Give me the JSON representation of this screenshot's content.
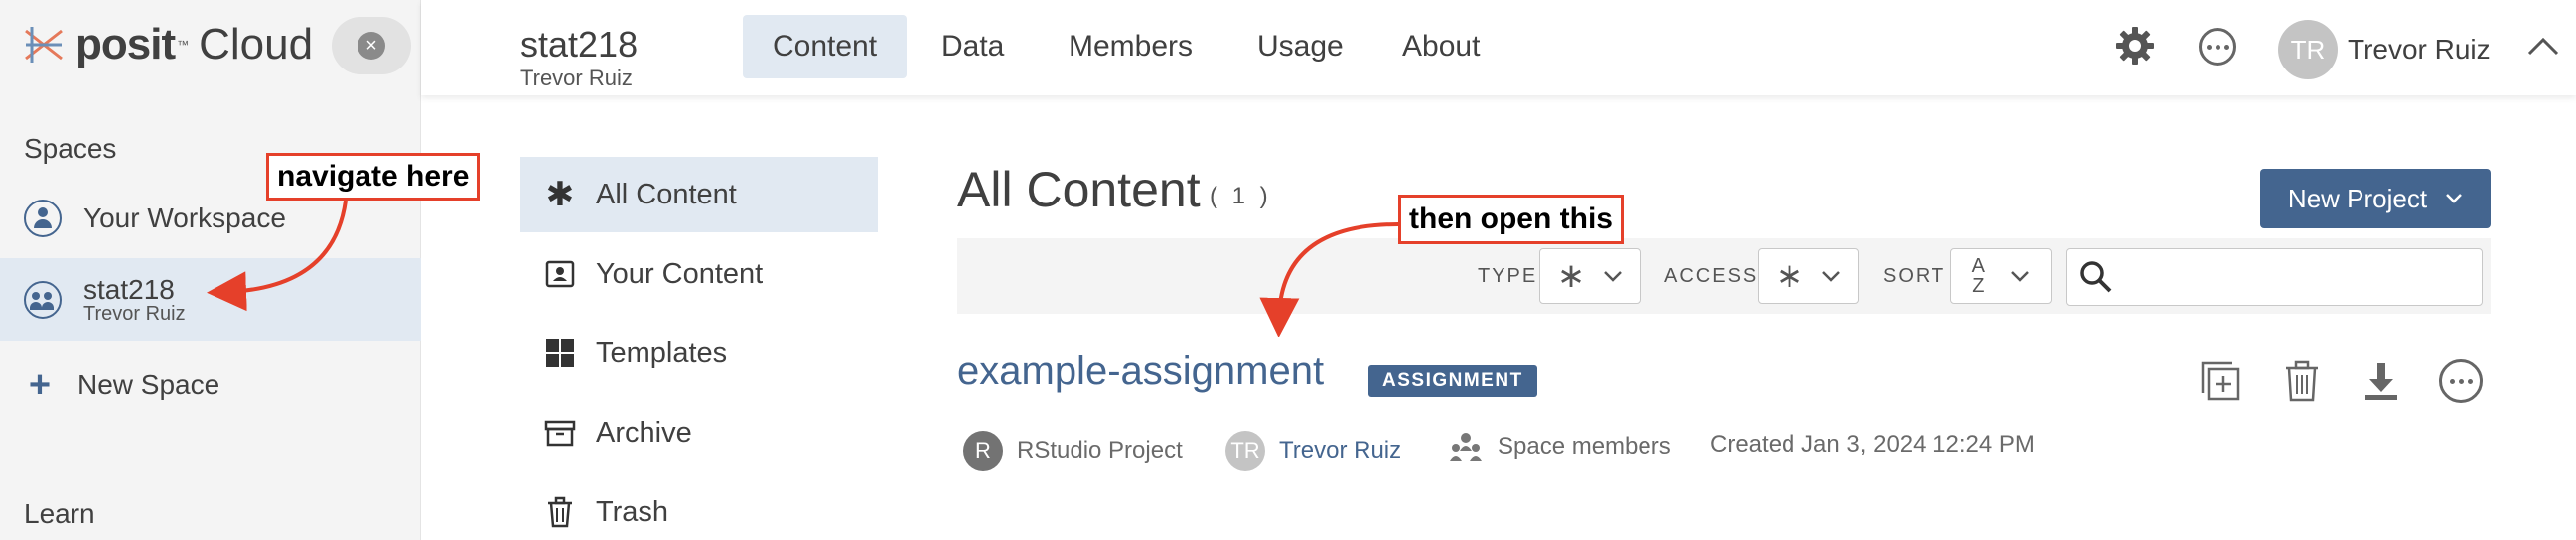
{
  "brand": {
    "name_bold": "posit",
    "name_light": "Cloud",
    "tm": "™"
  },
  "sidebar": {
    "spaces_heading": "Spaces",
    "items": [
      {
        "label": "Your Workspace"
      },
      {
        "label": "stat218",
        "sublabel": "Trevor Ruiz",
        "active": true
      },
      {
        "label": "New Space"
      }
    ],
    "learn_heading": "Learn"
  },
  "header": {
    "space_title": "stat218",
    "space_owner": "Trevor Ruiz",
    "tabs": [
      {
        "label": "Content",
        "active": true
      },
      {
        "label": "Data"
      },
      {
        "label": "Members"
      },
      {
        "label": "Usage"
      },
      {
        "label": "About"
      }
    ],
    "user": {
      "initials": "TR",
      "name": "Trevor Ruiz"
    }
  },
  "content_nav": {
    "items": [
      {
        "label": "All Content",
        "icon": "asterisk-icon",
        "active": true
      },
      {
        "label": "Your Content",
        "icon": "person-card-icon"
      },
      {
        "label": "Templates",
        "icon": "grid-icon"
      },
      {
        "label": "Archive",
        "icon": "archive-box-icon"
      },
      {
        "label": "Trash",
        "icon": "trash-icon"
      }
    ]
  },
  "main": {
    "title": "All Content",
    "count": "( 1 )",
    "new_project_label": "New Project",
    "filters": {
      "type_label": "TYPE",
      "access_label": "ACCESS",
      "sort_label": "SORT",
      "type_value": "∗",
      "access_value": "∗",
      "sort_value_top": "A",
      "sort_value_bottom": "Z",
      "search_placeholder": ""
    },
    "project": {
      "title": "example-assignment",
      "badge": "ASSIGNMENT",
      "type_initial": "R",
      "type_label": "RStudio Project",
      "owner_initials": "TR",
      "owner_name": "Trevor Ruiz",
      "access_label": "Space members",
      "created": "Created Jan 3, 2024 12:24 PM"
    }
  },
  "annotations": {
    "left": "navigate here",
    "right": "then open this",
    "color": "#e5402a"
  },
  "colors": {
    "accent": "#44658f",
    "active_bg": "#e1e9f2",
    "sidebar_bg": "#f4f4f4"
  }
}
